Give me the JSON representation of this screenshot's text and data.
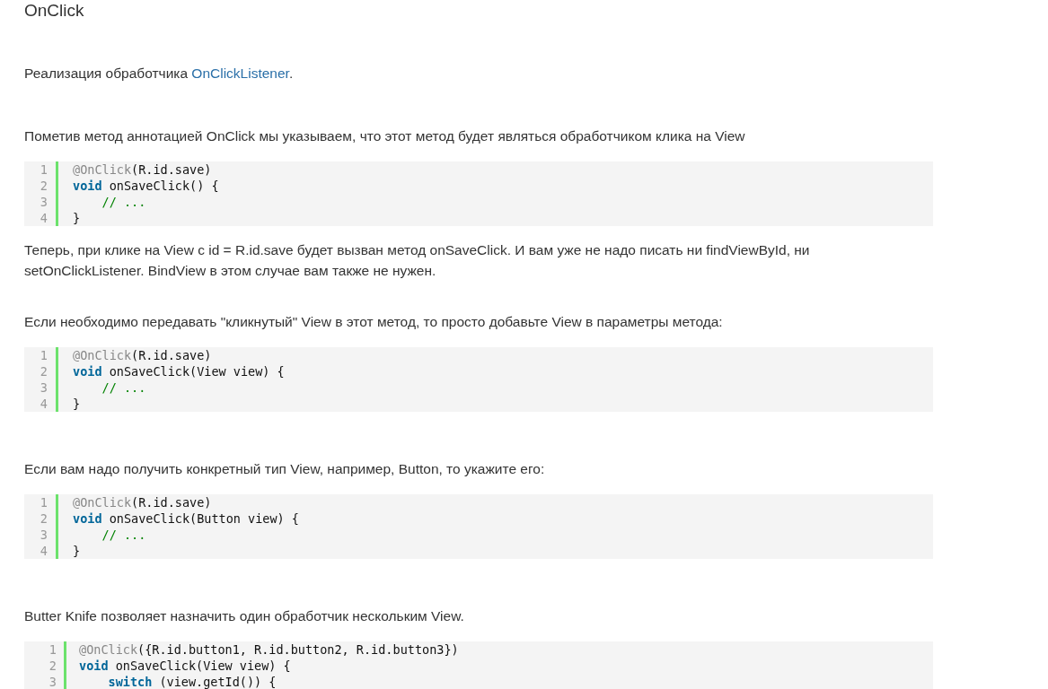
{
  "blocks": [
    {
      "kind": "heading",
      "text": "OnClick"
    },
    {
      "kind": "paragraph",
      "parts": [
        {
          "kind": "text",
          "text": "Реализация обработчика "
        },
        {
          "kind": "link",
          "text": "OnClickListener"
        },
        {
          "kind": "text",
          "text": "."
        }
      ]
    },
    {
      "kind": "paragraph",
      "parts": [
        {
          "kind": "text",
          "text": "Пометив метод аннотацией OnClick мы указываем, что этот метод будет являться обработчиком клика на View"
        }
      ]
    },
    {
      "kind": "code",
      "lines": [
        {
          "number": "1",
          "tokens": [
            {
              "kind": "annotation",
              "text": "@OnClick"
            },
            {
              "kind": "plain",
              "text": "(R.id.save)"
            }
          ]
        },
        {
          "number": "2",
          "tokens": [
            {
              "kind": "keyword",
              "text": "void"
            },
            {
              "kind": "plain",
              "text": " onSaveClick() {"
            }
          ]
        },
        {
          "number": "3",
          "indented": true,
          "tokens": [
            {
              "kind": "comment",
              "text": "// ..."
            }
          ]
        },
        {
          "number": "4",
          "tokens": [
            {
              "kind": "plain",
              "text": "}"
            }
          ]
        }
      ]
    },
    {
      "kind": "paragraph",
      "parts": [
        {
          "kind": "text",
          "text": "Теперь, при клике на View с id = R.id.save будет вызван метод onSaveClick. И вам уже не надо писать ни findViewById, ни setOnClickListener. BindView в этом случае вам также не нужен."
        }
      ]
    },
    {
      "kind": "paragraph",
      "parts": [
        {
          "kind": "text",
          "text": "Если необходимо передавать \"кликнутый\" View в этот метод, то просто добавьте View в параметры метода:"
        }
      ]
    },
    {
      "kind": "code",
      "lines": [
        {
          "number": "1",
          "tokens": [
            {
              "kind": "annotation",
              "text": "@OnClick"
            },
            {
              "kind": "plain",
              "text": "(R.id.save)"
            }
          ]
        },
        {
          "number": "2",
          "tokens": [
            {
              "kind": "keyword",
              "text": "void"
            },
            {
              "kind": "plain",
              "text": " onSaveClick(View view) {"
            }
          ]
        },
        {
          "number": "3",
          "indented": true,
          "tokens": [
            {
              "kind": "comment",
              "text": "// ..."
            }
          ]
        },
        {
          "number": "4",
          "tokens": [
            {
              "kind": "plain",
              "text": "}"
            }
          ]
        }
      ]
    },
    {
      "kind": "paragraph",
      "parts": [
        {
          "kind": "text",
          "text": "Если вам надо получить конкретный тип View, например, Button, то укажите его:"
        }
      ]
    },
    {
      "kind": "code",
      "lines": [
        {
          "number": "1",
          "tokens": [
            {
              "kind": "annotation",
              "text": "@OnClick"
            },
            {
              "kind": "plain",
              "text": "(R.id.save)"
            }
          ]
        },
        {
          "number": "2",
          "tokens": [
            {
              "kind": "keyword",
              "text": "void"
            },
            {
              "kind": "plain",
              "text": " onSaveClick(Button view) {"
            }
          ]
        },
        {
          "number": "3",
          "indented": true,
          "tokens": [
            {
              "kind": "comment",
              "text": "// ..."
            }
          ]
        },
        {
          "number": "4",
          "tokens": [
            {
              "kind": "plain",
              "text": "}"
            }
          ]
        }
      ]
    },
    {
      "kind": "paragraph",
      "parts": [
        {
          "kind": "text",
          "text": "Butter Knife позволяет назначить один обработчик нескольким View."
        }
      ]
    },
    {
      "kind": "code",
      "lines": [
        {
          "number": "1",
          "tokens": [
            {
              "kind": "annotation",
              "text": "@OnClick"
            },
            {
              "kind": "plain",
              "text": "({R.id.button1, R.id.button2, R.id.button3})"
            }
          ]
        },
        {
          "number": "2",
          "tokens": [
            {
              "kind": "keyword",
              "text": "void"
            },
            {
              "kind": "plain",
              "text": " onSaveClick(View view) {"
            }
          ]
        },
        {
          "number": "3",
          "indented": true,
          "tokens": [
            {
              "kind": "keyword",
              "text": "switch"
            },
            {
              "kind": "plain",
              "text": " (view.getId()) {"
            }
          ]
        }
      ]
    }
  ]
}
